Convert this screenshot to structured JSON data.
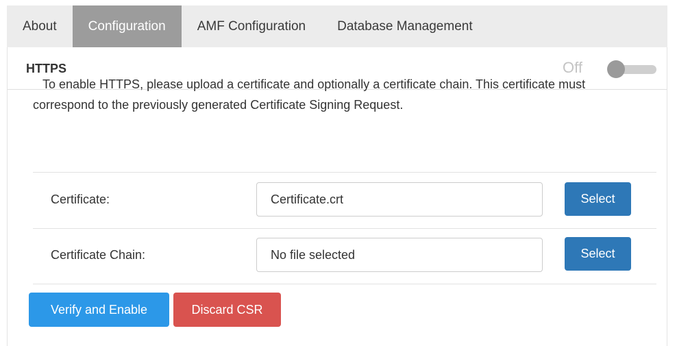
{
  "tabs": [
    {
      "label": "About",
      "active": false
    },
    {
      "label": "Configuration",
      "active": true
    },
    {
      "label": "AMF Configuration",
      "active": false
    },
    {
      "label": "Database Management",
      "active": false
    }
  ],
  "https": {
    "title": "HTTPS",
    "toggle_label": "Off",
    "toggle_state": false
  },
  "description": "To enable HTTPS, please upload a certificate and optionally a certificate chain. This certificate must correspond to the previously generated Certificate Signing Request.",
  "certificate": {
    "label": "Certificate:",
    "value": "Certificate.crt",
    "select_label": "Select"
  },
  "certificate_chain": {
    "label": "Certificate Chain:",
    "value": "No file selected",
    "select_label": "Select"
  },
  "actions": {
    "verify_label": "Verify and Enable",
    "discard_label": "Discard CSR"
  },
  "colors": {
    "active_tab_bg": "#9c9c9c",
    "tabbar_bg": "#ececec",
    "select_button": "#2e78b7",
    "verify_button": "#2c98e8",
    "discard_button": "#d9534f"
  }
}
